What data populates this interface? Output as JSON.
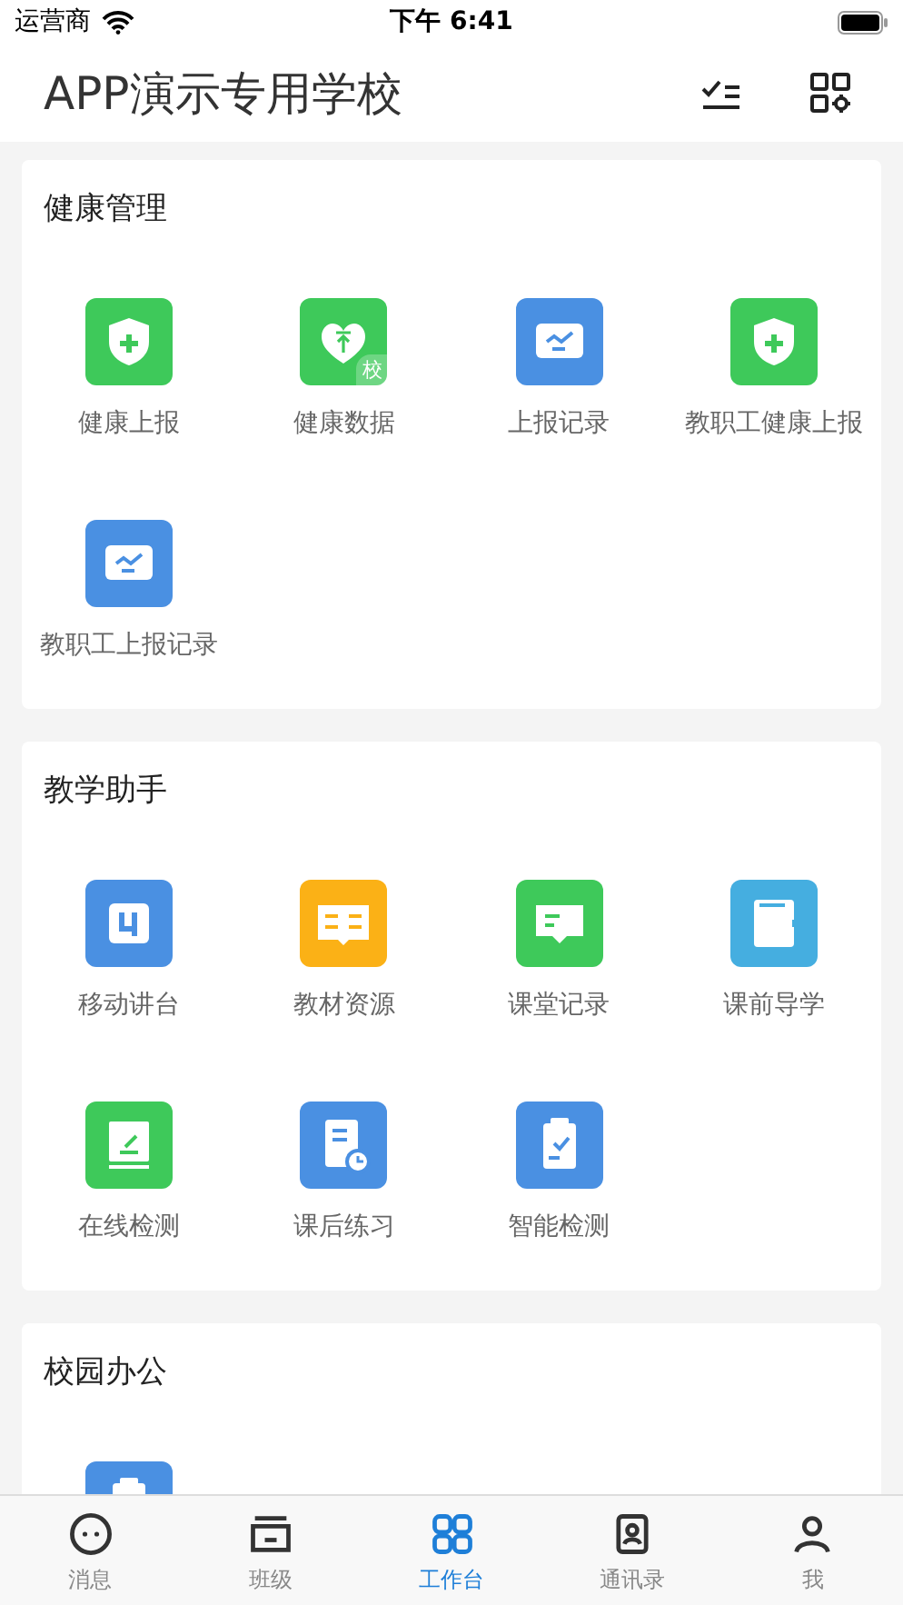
{
  "status_bar": {
    "carrier": "运营商",
    "time": "下午 6:41"
  },
  "header": {
    "title": "APP演示专用学校"
  },
  "sections": [
    {
      "title": "健康管理",
      "items": [
        {
          "label": "健康上报",
          "kind": "shield",
          "color": "#3ec95a"
        },
        {
          "label": "健康数据",
          "kind": "heart",
          "color": "#3ec95a",
          "badge": "校"
        },
        {
          "label": "上报记录",
          "kind": "chart",
          "color": "#4a90e2"
        },
        {
          "label": "教职工健康上报",
          "kind": "shield",
          "color": "#3ec95a"
        },
        {
          "label": "教职工上报记录",
          "kind": "chart",
          "color": "#4a90e2"
        }
      ]
    },
    {
      "title": "教学助手",
      "items": [
        {
          "label": "移动讲台",
          "kind": "lectern",
          "color": "#4a90e2"
        },
        {
          "label": "教材资源",
          "kind": "book",
          "color": "#fbb116"
        },
        {
          "label": "课堂记录",
          "kind": "chat",
          "color": "#3ec95a"
        },
        {
          "label": "课前导学",
          "kind": "wallet",
          "color": "#45aee0"
        },
        {
          "label": "在线检测",
          "kind": "pen",
          "color": "#3ec95a"
        },
        {
          "label": "课后练习",
          "kind": "clock",
          "color": "#4a90e2"
        },
        {
          "label": "智能检测",
          "kind": "clipboard",
          "color": "#4a90e2"
        }
      ]
    },
    {
      "title": "校园办公",
      "items": [
        {
          "kind": "clipboard",
          "color": "#4a90e2"
        }
      ]
    }
  ],
  "tab_bar": [
    {
      "label": "消息",
      "kind": "chat",
      "selected": false
    },
    {
      "label": "班级",
      "kind": "class",
      "selected": false
    },
    {
      "label": "工作台",
      "kind": "grid",
      "selected": true
    },
    {
      "label": "通讯录",
      "kind": "contacts",
      "selected": false
    },
    {
      "label": "我",
      "kind": "person",
      "selected": false
    }
  ]
}
